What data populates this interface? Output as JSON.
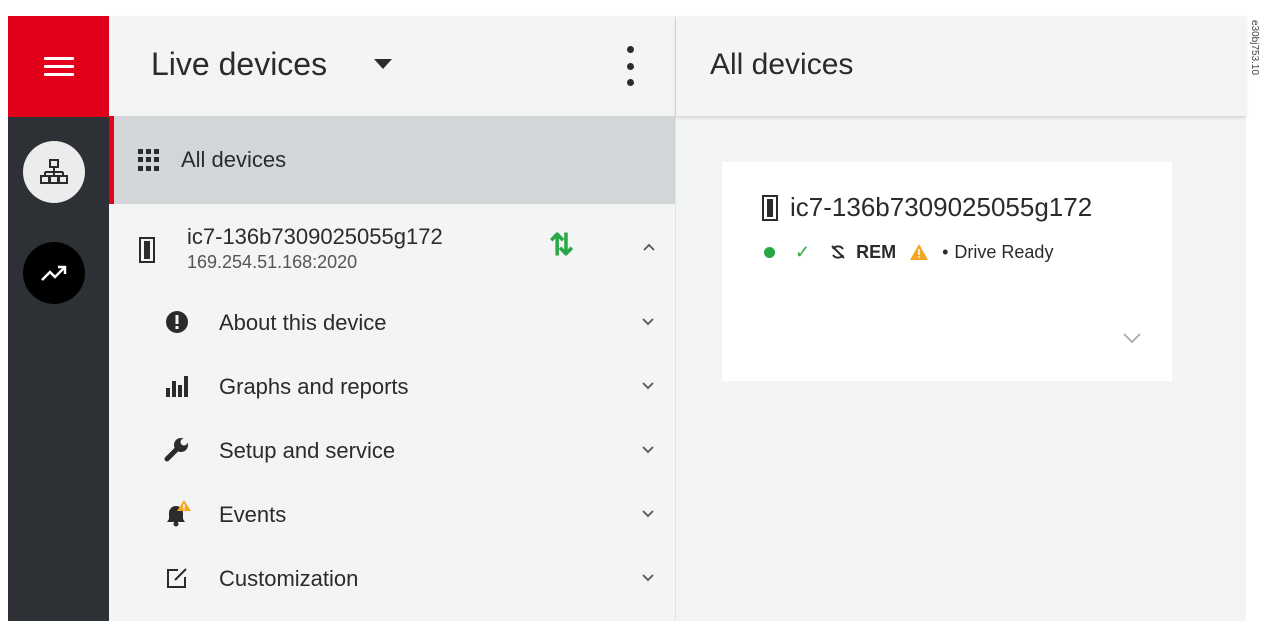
{
  "rail": {
    "menu_icon": "hamburger-icon",
    "network_icon": "network-tree-icon",
    "trend_icon": "trend-icon",
    "brand_color": "#e2001a"
  },
  "panel": {
    "title": "Live devices",
    "all_devices_label": "All devices",
    "device": {
      "name": "ic7-136b7309025055g172",
      "address": "169.254.51.168:2020",
      "sync_icon": "⇅"
    },
    "sub_items": [
      {
        "label": "About this device",
        "icon": "info-icon"
      },
      {
        "label": "Graphs and reports",
        "icon": "bar-chart-icon"
      },
      {
        "label": "Setup and service",
        "icon": "wrench-icon"
      },
      {
        "label": "Events",
        "icon": "bell-warning-icon"
      },
      {
        "label": "Customization",
        "icon": "edit-icon"
      }
    ]
  },
  "content": {
    "title": "All devices",
    "card": {
      "name": "ic7-136b7309025055g172",
      "check": "✓",
      "rem": "REM",
      "separator": "•",
      "status_text": "Drive Ready"
    }
  },
  "stamp": "e30bj753.10"
}
